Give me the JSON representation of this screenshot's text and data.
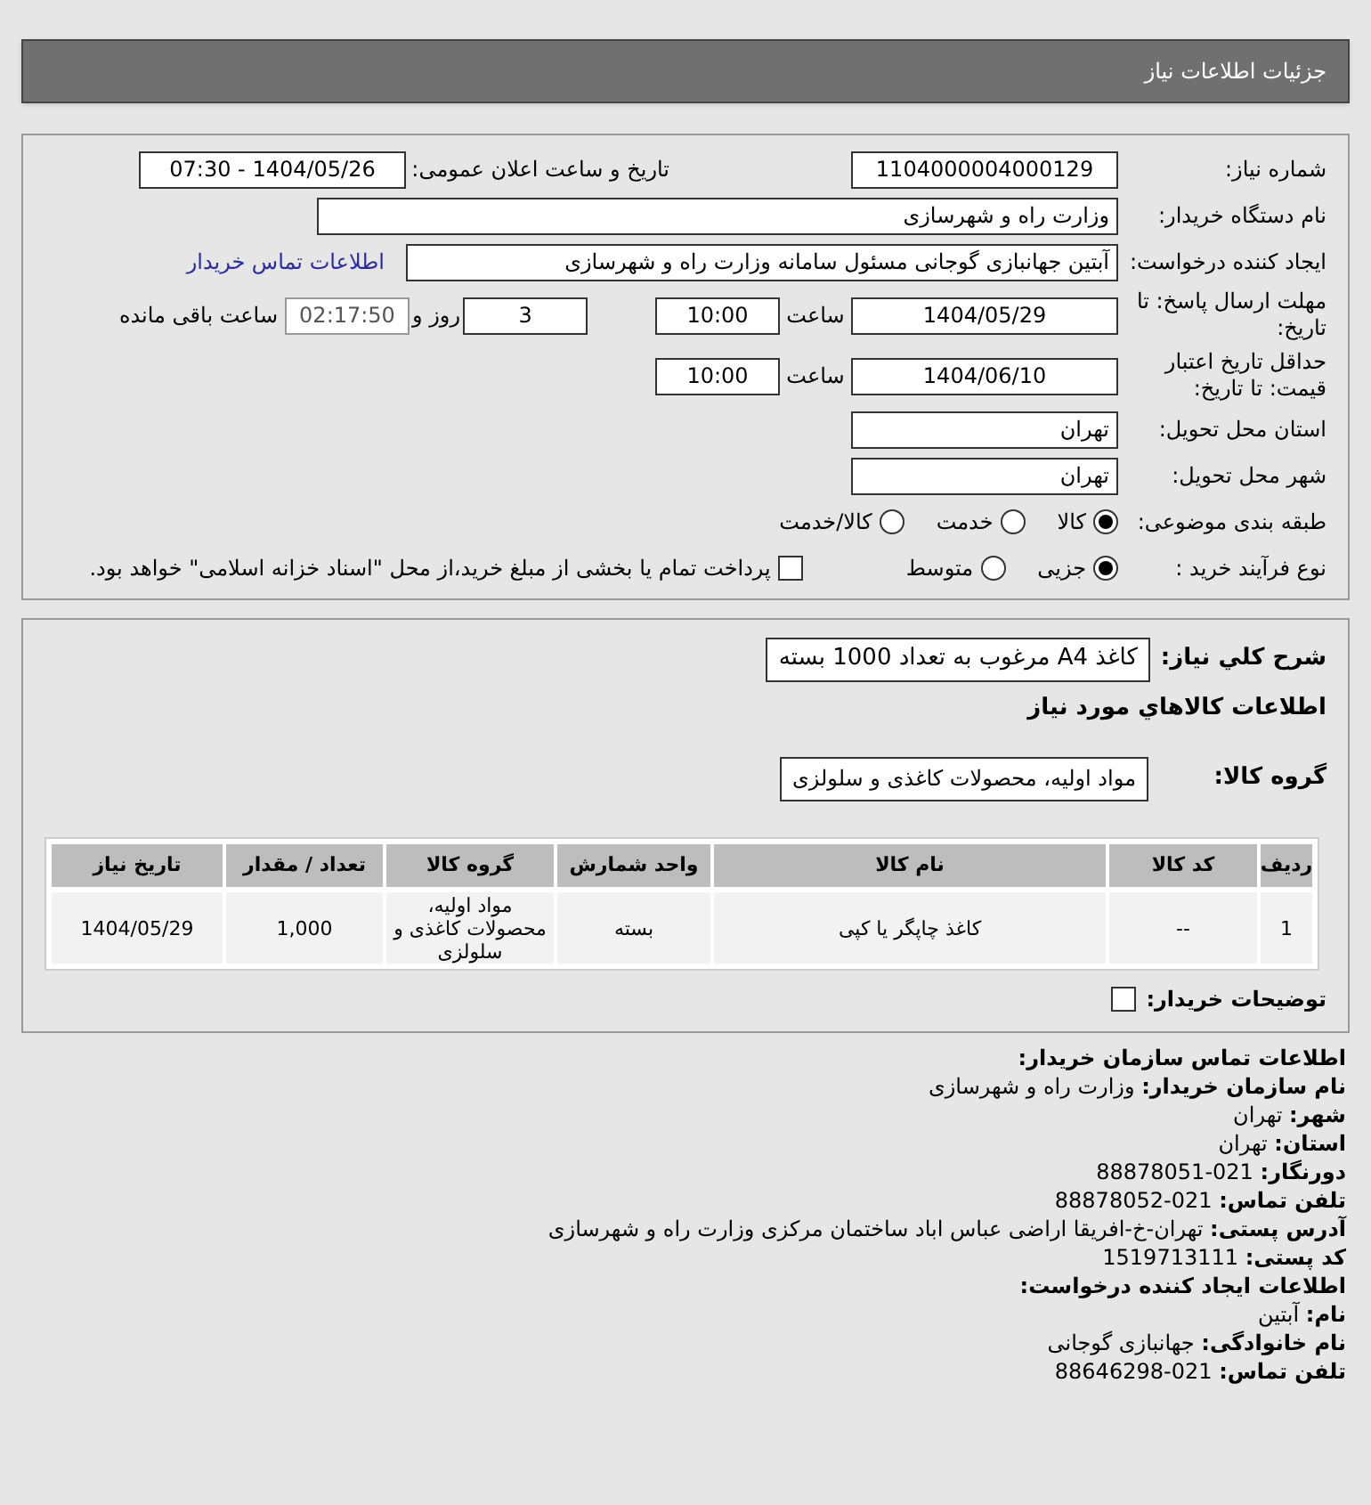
{
  "header": {
    "title": "جزئیات اطلاعات نیاز"
  },
  "form": {
    "need_number": {
      "label": "شماره نیاز:",
      "value": "1104000004000129"
    },
    "announce": {
      "label": "تاریخ و ساعت اعلان عمومی:",
      "value": "1404/05/26 - 07:30"
    },
    "buyer": {
      "label": "نام دستگاه خریدار:",
      "value": "وزارت راه و شهرسازی"
    },
    "creator": {
      "label": "ایجاد کننده درخواست:",
      "value": "آبتین جهانبازی گوجانی مسئول سامانه وزارت راه و شهرسازی",
      "link": "اطلاعات تماس خریدار"
    },
    "deadline": {
      "label": "مهلت ارسال پاسخ: تا تاریخ:",
      "date": "1404/05/29",
      "time_label": "ساعت",
      "time": "10:00",
      "days": "3",
      "days_label": "روز و",
      "remaining": "02:17:50",
      "remaining_label": "ساعت باقی مانده"
    },
    "validity": {
      "label": "حداقل تاریخ اعتبار قیمت: تا تاریخ:",
      "date": "1404/06/10",
      "time_label": "ساعت",
      "time": "10:00"
    },
    "province": {
      "label": "استان محل تحویل:",
      "value": "تهران"
    },
    "city": {
      "label": "شهر محل تحویل:",
      "value": "تهران"
    },
    "category": {
      "label": "طبقه بندی موضوعی:",
      "options": [
        {
          "label": "کالا",
          "selected": true
        },
        {
          "label": "خدمت",
          "selected": false
        },
        {
          "label": "کالا/خدمت",
          "selected": false
        }
      ]
    },
    "process": {
      "label": "نوع فرآیند خرید :",
      "options": [
        {
          "label": "جزیی",
          "selected": true
        },
        {
          "label": "متوسط",
          "selected": false
        }
      ],
      "payment": {
        "checked": false,
        "label": "پرداخت تمام یا بخشی از مبلغ خرید،از محل \"اسناد خزانه اسلامی\" خواهد بود."
      }
    }
  },
  "goods": {
    "description": {
      "label": "شرح کلي نياز:",
      "value": "کاغذ A4 مرغوب به تعداد 1000 بسته"
    },
    "heading": "اطلاعات كالاهاي مورد نياز",
    "group": {
      "label": "گروه کالا:",
      "value": "مواد اولیه، محصولات کاغذی و سلولزی"
    },
    "table": {
      "columns": [
        "ردیف",
        "کد کالا",
        "نام کالا",
        "واحد شمارش",
        "گروه کالا",
        "تعداد / مقدار",
        "تاریخ نیاز"
      ],
      "rows": [
        [
          "1",
          "--",
          "کاغذ چاپگر یا کپی",
          "بسته",
          "مواد اولیه، محصولات کاغذی و سلولزی",
          "1,000",
          "1404/05/29"
        ]
      ]
    },
    "notes": {
      "label": "توضیحات خریدار:",
      "checked": false
    }
  },
  "contact": [
    {
      "kind": "heading",
      "label": "اطلاعات تماس سازمان خریدار:"
    },
    {
      "kind": "line",
      "label": "نام سازمان خریدار:",
      "value": "وزارت راه و شهرسازی"
    },
    {
      "kind": "line",
      "label": "شهر:",
      "value": "تهران"
    },
    {
      "kind": "line",
      "label": "استان:",
      "value": "تهران"
    },
    {
      "kind": "line",
      "label": "دورنگار:",
      "value": "021-88878051"
    },
    {
      "kind": "line",
      "label": "تلفن تماس:",
      "value": "021-88878052"
    },
    {
      "kind": "line",
      "label": "آدرس پستی:",
      "value": "تهران-خ-افریقا اراضی عباس اباد ساختمان مرکزی وزارت راه و شهرسازی"
    },
    {
      "kind": "line",
      "label": "کد پستی:",
      "value": "1519713111"
    },
    {
      "kind": "heading",
      "label": "اطلاعات ایجاد کننده درخواست:"
    },
    {
      "kind": "line",
      "label": "نام:",
      "value": "آبتین"
    },
    {
      "kind": "line",
      "label": "نام خانوادگی:",
      "value": "جهانبازی گوجانی"
    },
    {
      "kind": "line",
      "label": "تلفن تماس:",
      "value": "021-88646298"
    }
  ]
}
